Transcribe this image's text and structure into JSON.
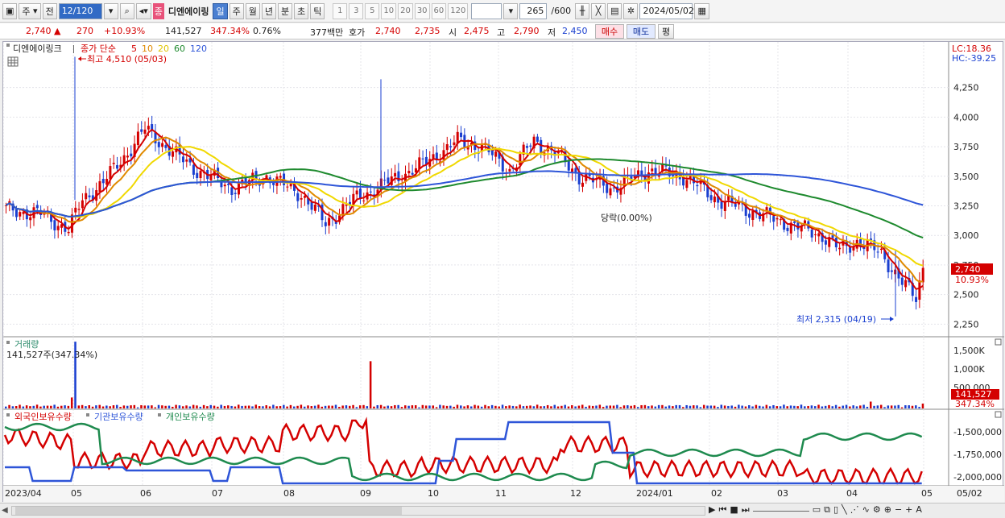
{
  "toolbar": {
    "period_unit": "주",
    "prev_label": "전",
    "stock_code": "12/120",
    "stock_badge": "종",
    "stock_name": "디엔에이링",
    "tabs": [
      "일",
      "주",
      "월",
      "년",
      "분",
      "초",
      "틱"
    ],
    "periods": [
      "1",
      "3",
      "5",
      "10",
      "20",
      "30",
      "60",
      "120"
    ],
    "count": "265",
    "count_max": "/600",
    "date": "2024/05/02"
  },
  "quote": {
    "price": "2,740",
    "change": "270",
    "change_pct": "+10.93%",
    "volume": "141,527",
    "volume_pct": "347.34%",
    "turnover": "0.76%",
    "amount": "377백만",
    "ask_label": "호가",
    "ask1": "2,740",
    "ask2": "2,735",
    "open_label": "시",
    "open": "2,475",
    "high_label": "고",
    "high": "2,790",
    "low_label": "저",
    "low": "2,450",
    "buy_label": "매수",
    "sell_label": "매도",
    "eval_label": "평"
  },
  "price_panel": {
    "stock_name": "디엔에이링크",
    "ma_label": "종가 단순",
    "ma_periods": [
      "5",
      "10",
      "20",
      "60",
      "120"
    ],
    "ma_colors": [
      "#d40000",
      "#e08a00",
      "#f0d800",
      "#1e8a2e",
      "#2e55d8"
    ],
    "high_annotation": "최고 4,510 (05/03)",
    "low_annotation": "최저 2,315 (04/19)",
    "mid_annotation": "당락(0.00%)",
    "lc": "LC:18.36",
    "hc": "HC:-39.25",
    "current_price_tag": "2,740",
    "current_pct_tag": "10.93%",
    "y_ticks": [
      "4,250",
      "4,000",
      "3,750",
      "3,500",
      "3,250",
      "3,000",
      "2,750",
      "2,500",
      "2,250"
    ]
  },
  "volume_panel": {
    "title": "거래량",
    "value": "141,527주(347.34%)",
    "y_ticks": [
      "1,500K",
      "1,000K",
      "500,000"
    ],
    "current_tag": "141,527",
    "current_pct": "347.34%"
  },
  "holdings_panel": {
    "series": [
      {
        "name": "외국인보유수량",
        "color": "#d40000"
      },
      {
        "name": "기관보유수량",
        "color": "#2e55d8"
      },
      {
        "name": "개인보유수량",
        "color": "#1e8a4e"
      }
    ],
    "y_ticks": [
      "-1,500,000",
      "-1,750,000",
      "-2,000,000"
    ]
  },
  "x_axis": [
    "2023/04",
    "05",
    "06",
    "07",
    "08",
    "09",
    "10",
    "11",
    "12",
    "2024/01",
    "02",
    "03",
    "04",
    "05",
    "05/02"
  ]
}
